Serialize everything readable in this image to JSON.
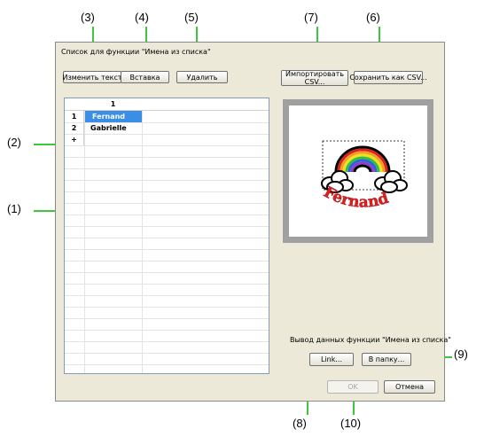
{
  "dialog": {
    "title": "Список для функции \"Имена из списка\"",
    "buttons": {
      "edit_text": "Изменить текст",
      "insert": "Вставка",
      "delete": "Удалить",
      "import_csv": "Импортировать CSV...",
      "save_csv": "Сохранить как CSV...",
      "link": "Link...",
      "to_folder": "В папку...",
      "ok": "OK",
      "cancel": "Отмена"
    },
    "ok_enabled": false,
    "grid": {
      "column_headers": [
        "1"
      ],
      "rows": [
        {
          "index": "1",
          "value": "Fernand",
          "selected": true
        },
        {
          "index": "2",
          "value": "Gabrielle",
          "selected": false
        }
      ],
      "new_row_marker": "+"
    },
    "preview": {
      "text": "Fernand",
      "text_color": "#e02020",
      "motif": "rainbow-cloud"
    },
    "output_label": "Вывод данных функции \"Имена из списка\""
  },
  "callouts": [
    "(1)",
    "(2)",
    "(3)",
    "(4)",
    "(5)",
    "(6)",
    "(7)",
    "(8)",
    "(9)",
    "(10)"
  ],
  "colors": {
    "selection": "#3a8ee6",
    "callout_line": "#3cc83c",
    "dialog_bg": "#ece9d8"
  }
}
